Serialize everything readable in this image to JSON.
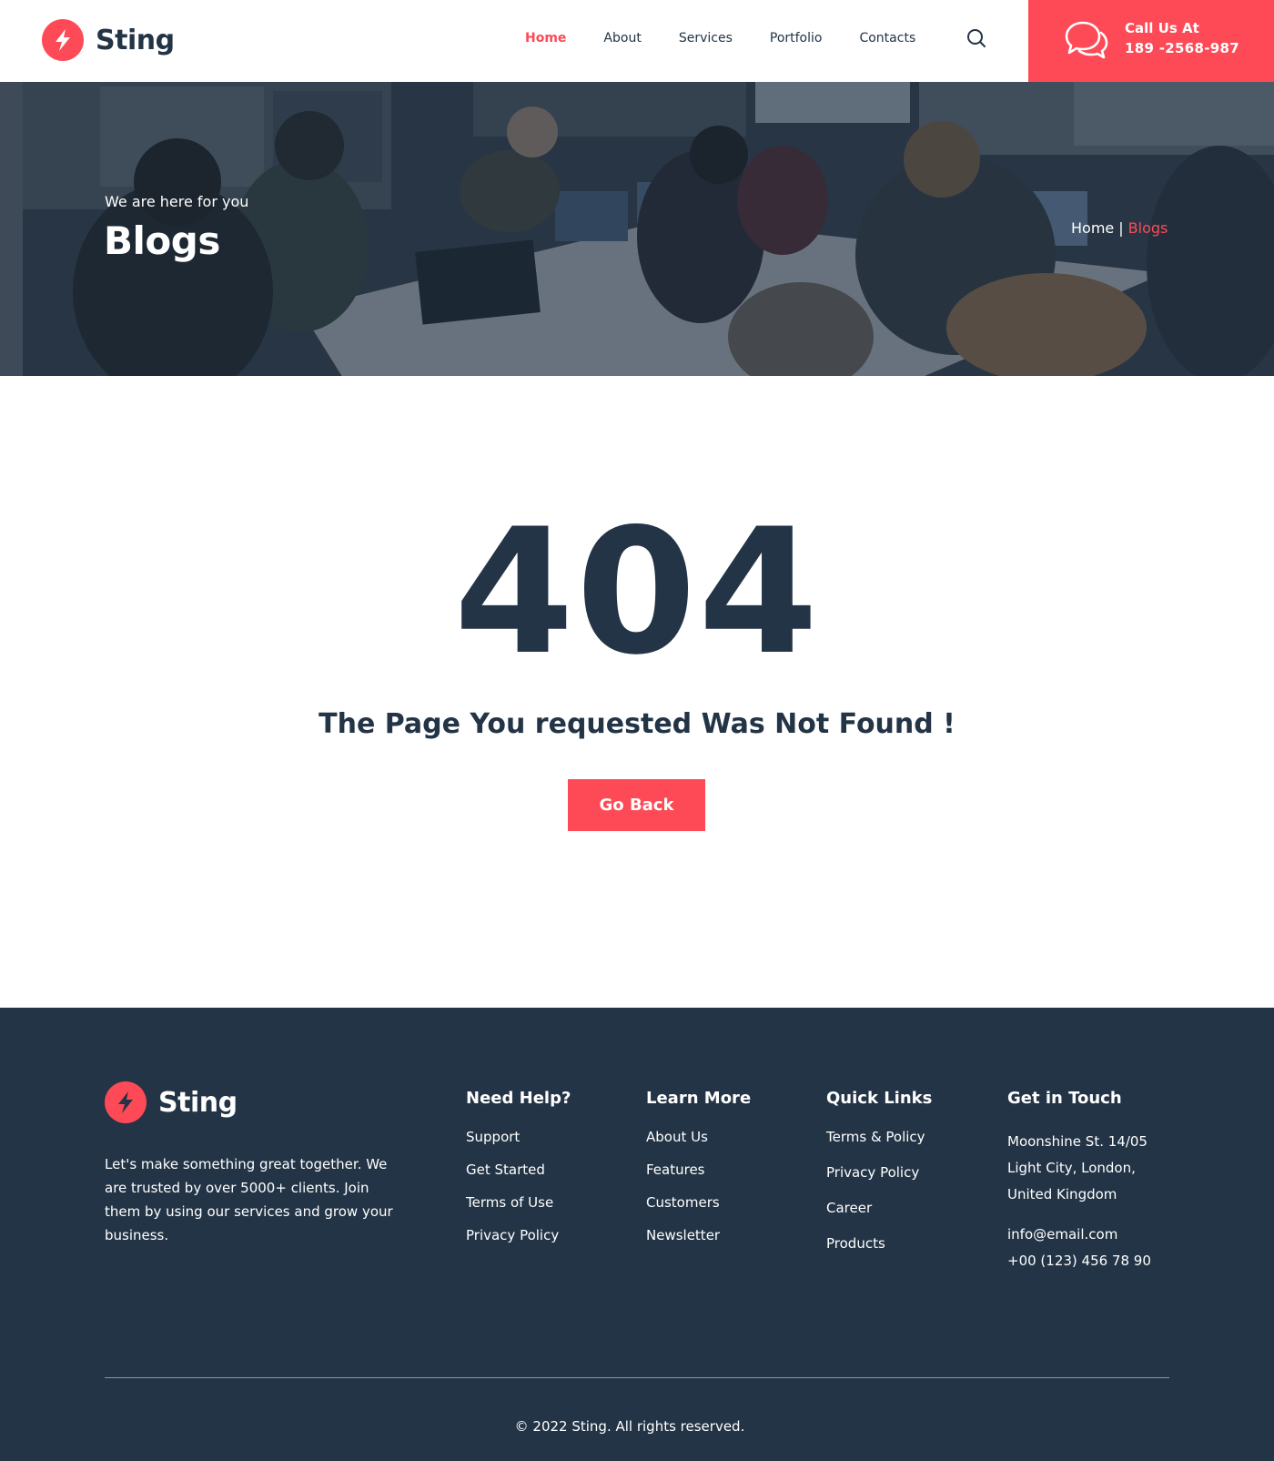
{
  "brand": {
    "name": "Sting",
    "accent": "#fd4a56",
    "dark": "#233446"
  },
  "nav": [
    {
      "label": "Home",
      "active": true
    },
    {
      "label": "About",
      "active": false
    },
    {
      "label": "Services",
      "active": false
    },
    {
      "label": "Portfolio",
      "active": false
    },
    {
      "label": "Contacts",
      "active": false
    }
  ],
  "header": {
    "search_icon": "search-icon",
    "call_label": "Call Us At",
    "call_number": "189 -2568-987",
    "call_icon": "chat-bubbles-icon"
  },
  "hero": {
    "subtitle": "We are here for you",
    "title": "Blogs",
    "breadcrumb": {
      "home": "Home",
      "separator": "|",
      "current": "Blogs"
    }
  },
  "error": {
    "code": "404",
    "message": "The Page You requested Was Not Found !",
    "button": "Go Back"
  },
  "footer": {
    "brand": "Sting",
    "description": "Let's make something great together. We are trusted by over 5000+ clients. Join them by using our services and grow your business.",
    "columns": {
      "help": {
        "title": "Need Help?",
        "links": [
          "Support",
          "Get Started",
          "Terms of Use",
          "Privacy Policy"
        ]
      },
      "learn": {
        "title": "Learn More",
        "links": [
          "About Us",
          "Features",
          "Customers",
          "Newsletter"
        ]
      },
      "quick": {
        "title": "Quick Links",
        "links": [
          "Terms & Policy",
          "Privacy Policy",
          "Career",
          "Products"
        ]
      },
      "touch": {
        "title": "Get in Touch",
        "address_lines": [
          "Moonshine St. 14/05",
          "Light City, London,",
          "United Kingdom"
        ],
        "email": "info@email.com",
        "phone": "+00 (123) 456 78 90"
      }
    },
    "copyright": "© 2022 Sting. All rights reserved."
  }
}
